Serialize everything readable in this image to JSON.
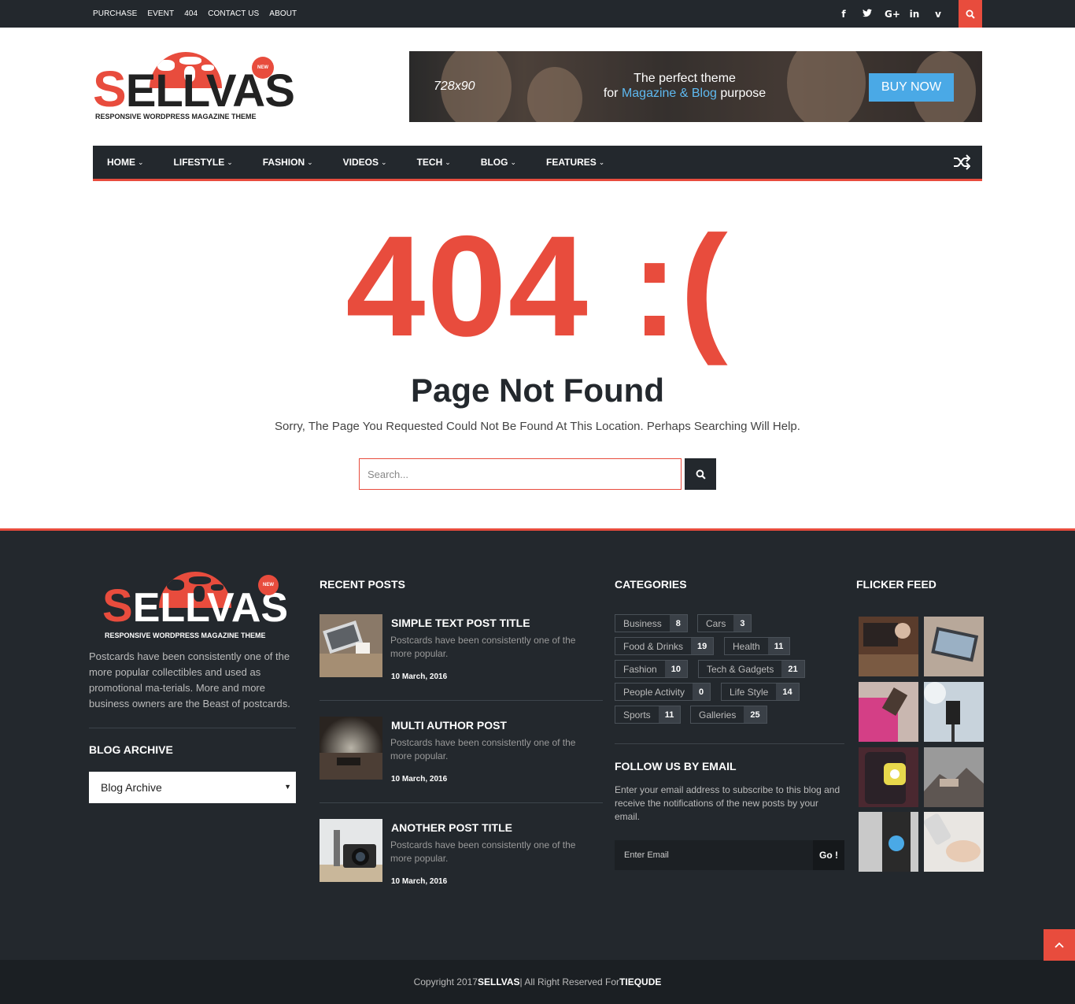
{
  "topbar": {
    "links": [
      "PURCHASE",
      "EVENT",
      "404",
      "CONTACT US",
      "ABOUT"
    ],
    "social_icons": [
      "facebook-icon",
      "twitter-icon",
      "google-plus-icon",
      "linkedin-icon",
      "vimeo-icon"
    ],
    "social_glyphs": [
      "f",
      "t",
      "G+",
      "in",
      "v"
    ]
  },
  "logo": {
    "first_letter": "S",
    "rest": "ELLVAS",
    "tagline": "RESPONSIVE WORDPRESS MAGAZINE THEME",
    "badge": "NEW"
  },
  "banner": {
    "size": "728x90",
    "line1": "The perfect theme",
    "line2_pre": "for ",
    "line2_hl": "Magazine & Blog",
    "line2_post": " purpose",
    "button": "BUY NOW"
  },
  "nav": {
    "items": [
      "HOME",
      "LIFESTYLE",
      "FASHION",
      "VIDEOS",
      "TECH",
      "BLOG",
      "FEATURES"
    ]
  },
  "error": {
    "code": "404 :(",
    "title": "Page Not Found",
    "message": "Sorry, The Page You Requested Could Not Be Found At This Location. Perhaps Searching Will Help.",
    "search_placeholder": "Search..."
  },
  "footer": {
    "about": "Postcards have been consistently one of the more popular collectibles and used as promotional ma-terials. More and more business owners are the Beast of postcards.",
    "blog_archive_heading": "BLOG ARCHIVE",
    "blog_archive_select": "Blog Archive",
    "recent_heading": "RECENT POSTS",
    "posts": [
      {
        "title": "SIMPLE TEXT POST TITLE",
        "excerpt": "Postcards have been consistently one of the more popular.",
        "date": "10 March, 2016"
      },
      {
        "title": "MULTI AUTHOR POST",
        "excerpt": "Postcards have been consistently one of the more popular.",
        "date": "10 March, 2016"
      },
      {
        "title": "ANOTHER POST TITLE",
        "excerpt": "Postcards have been consistently one of the more popular.",
        "date": "10 March, 2016"
      }
    ],
    "categories_heading": "CATEGORIES",
    "categories": [
      {
        "name": "Business",
        "count": "8"
      },
      {
        "name": "Cars",
        "count": "3"
      },
      {
        "name": "Food & Drinks",
        "count": "19"
      },
      {
        "name": "Health",
        "count": "11"
      },
      {
        "name": "Fashion",
        "count": "10"
      },
      {
        "name": "Tech & Gadgets",
        "count": "21"
      },
      {
        "name": "People Activity",
        "count": "0"
      },
      {
        "name": "Life Style",
        "count": "14"
      },
      {
        "name": "Sports",
        "count": "11"
      },
      {
        "name": "Galleries",
        "count": "25"
      }
    ],
    "follow_heading": "FOLLOW US BY EMAIL",
    "follow_text": "Enter your email address to subscribe to this blog and receive the notifications of the new posts by your email.",
    "email_placeholder": "Enter Email",
    "go_label": "Go !",
    "flicker_heading": "FLICKER FEED",
    "copyright_pre": "Copyright 2017 ",
    "copyright_brand": "SELLVAS",
    "copyright_mid": " | All Right Reserved For ",
    "copyright_author": "TIEQUDE"
  },
  "colors": {
    "accent": "#e84c3d",
    "dark": "#23282d",
    "link_blue": "#4aa9e6"
  }
}
